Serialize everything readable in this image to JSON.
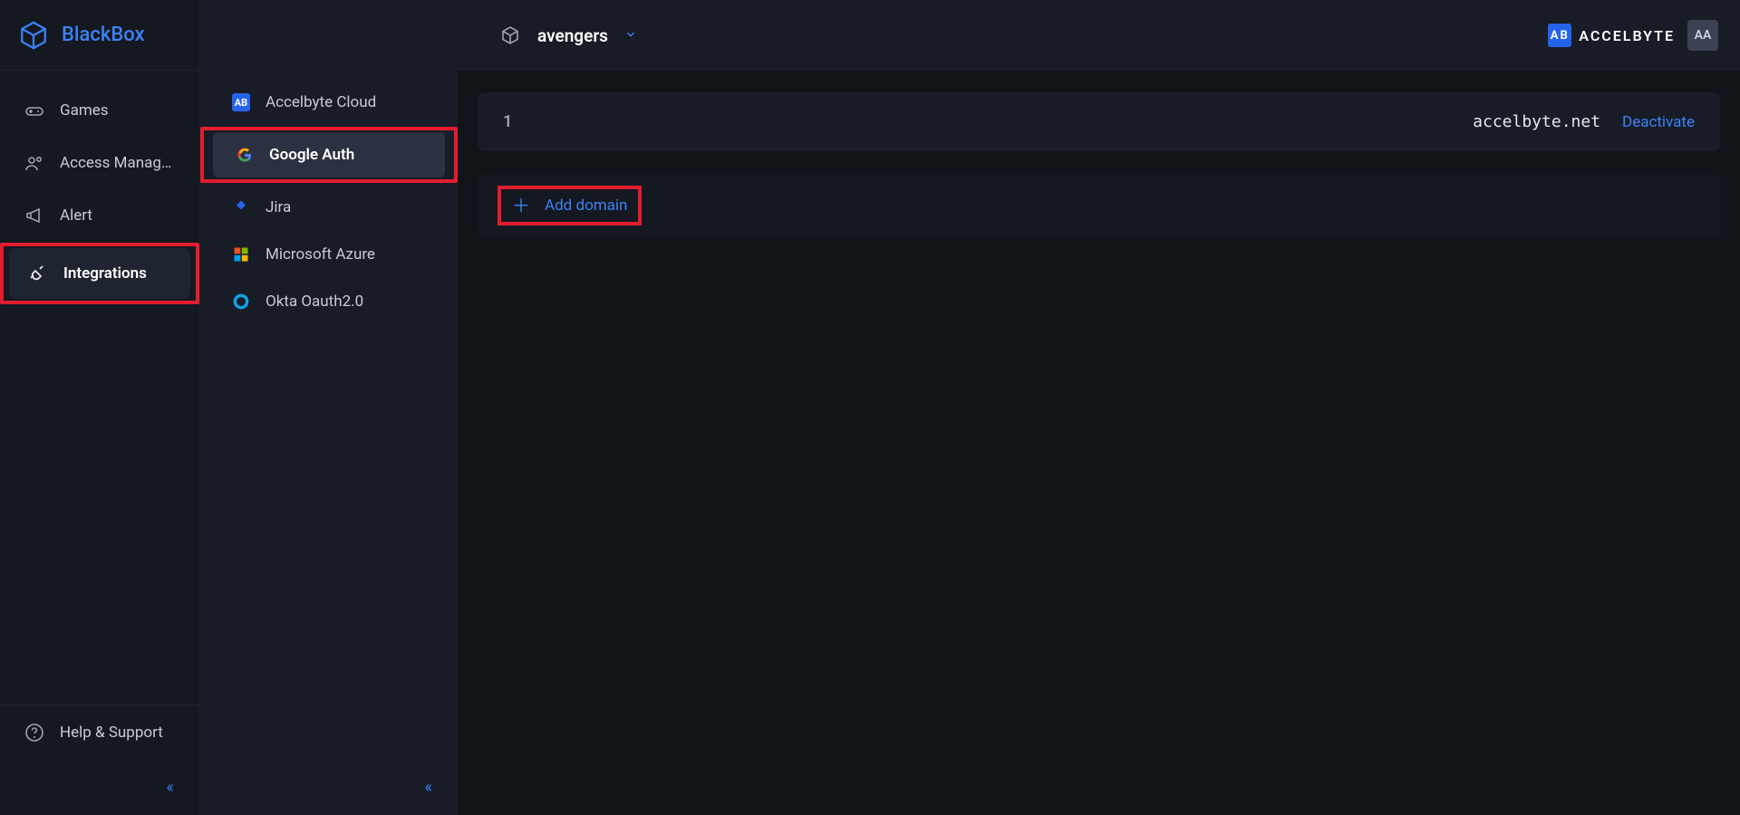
{
  "brand": {
    "name": "BlackBox"
  },
  "sidebar": {
    "items": [
      {
        "label": "Games"
      },
      {
        "label": "Access Manage…"
      },
      {
        "label": "Alert"
      },
      {
        "label": "Integrations"
      }
    ],
    "footer": {
      "help_label": "Help & Support"
    }
  },
  "subnav": {
    "items": [
      {
        "label": "Accelbyte Cloud"
      },
      {
        "label": "Google Auth"
      },
      {
        "label": "Jira"
      },
      {
        "label": "Microsoft Azure"
      },
      {
        "label": "Okta Oauth2.0"
      }
    ]
  },
  "topbar": {
    "project": "avengers",
    "vendor": "ACCELBYTE",
    "vendor_mark": "AB",
    "avatar": "AA"
  },
  "domains": {
    "rows": [
      {
        "index": "1",
        "domain": "accelbyte.net",
        "action": "Deactivate"
      }
    ],
    "add_label": "Add domain"
  }
}
